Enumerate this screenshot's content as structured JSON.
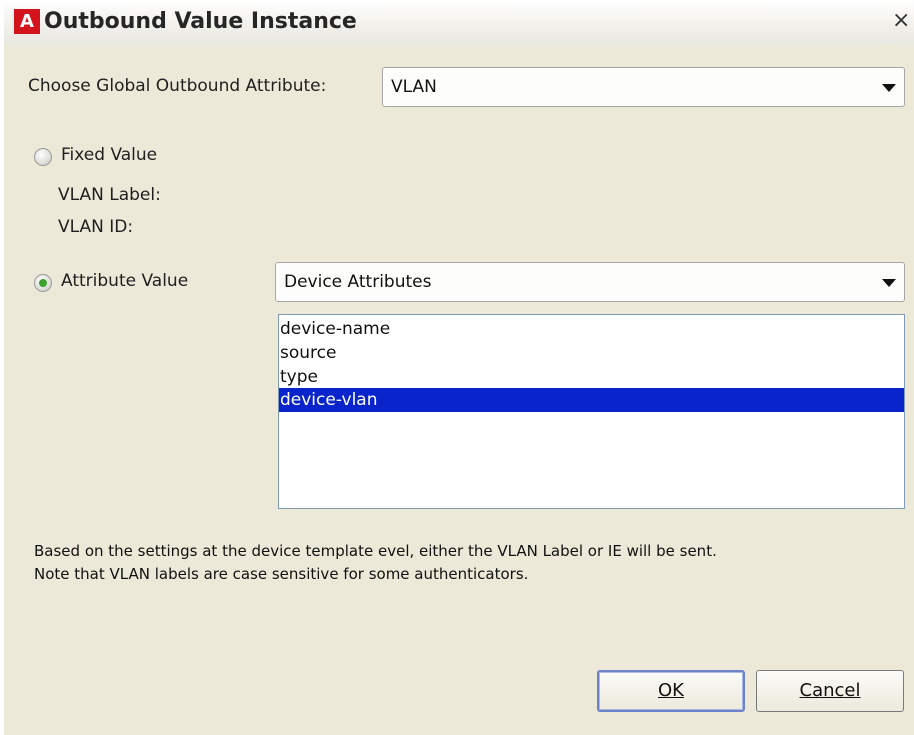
{
  "window": {
    "title": "Outbound Value Instance",
    "app_icon_letter": "A",
    "close_glyph": "×"
  },
  "global_attribute": {
    "label": "Choose Global Outbound Attribute:",
    "value": "VLAN"
  },
  "fixed_value": {
    "label": "Fixed Value",
    "selected": false,
    "vlan_label_label": "VLAN Label:",
    "vlan_id_label": "VLAN ID:"
  },
  "attribute_value": {
    "label": "Attribute Value",
    "selected": true,
    "category": "Device Attributes",
    "items": [
      "device-name",
      "source",
      "type",
      "device-vlan"
    ],
    "selected_item": "device-vlan"
  },
  "note": {
    "line1": "Based on the settings at the device template evel, either the VLAN Label or IE will be sent.",
    "line2": "Note that VLAN labels are case sensitive for some authenticators."
  },
  "buttons": {
    "ok": "OK",
    "cancel": "Cancel"
  },
  "colors": {
    "selection": "#0a24cc",
    "dialog_bg": "#ece9d8",
    "radio_dot": "#3da12e"
  }
}
